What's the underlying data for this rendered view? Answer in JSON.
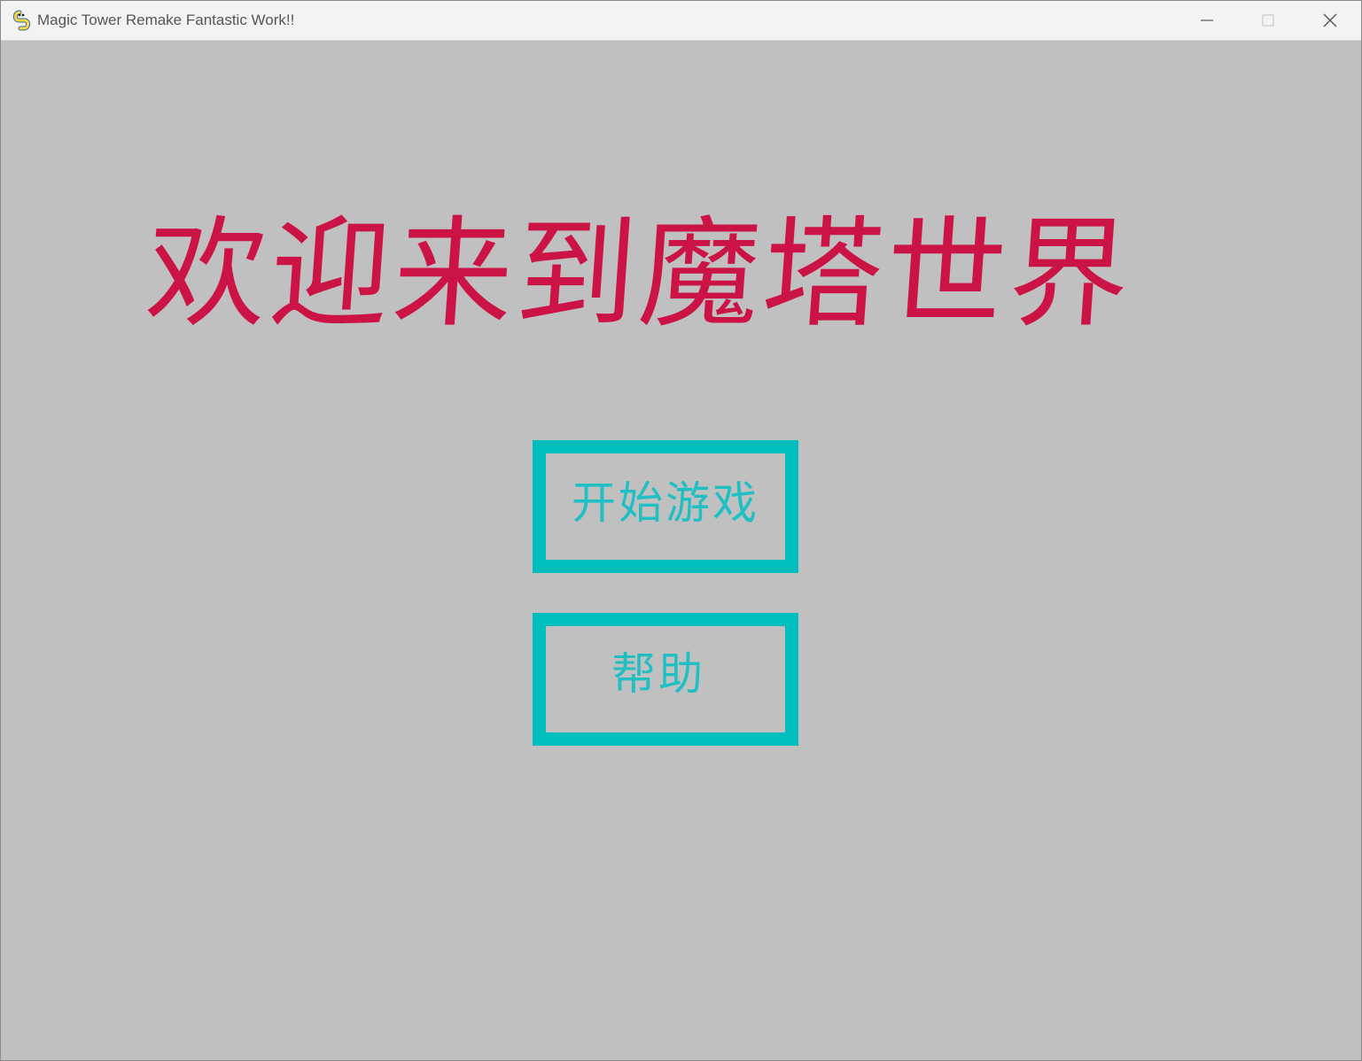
{
  "window": {
    "title": "Magic Tower Remake Fantastic Work!!",
    "icon": "pygame-snake-icon",
    "controls": [
      "minimize-icon",
      "maximize-icon",
      "close-icon"
    ]
  },
  "game": {
    "background_color": "#c0c0c0",
    "title": "欢迎来到魔塔世界",
    "title_color": "#cc1346",
    "button_color": "#00bebe",
    "buttons": [
      {
        "label": "开始游戏"
      },
      {
        "label": "帮助"
      }
    ]
  }
}
